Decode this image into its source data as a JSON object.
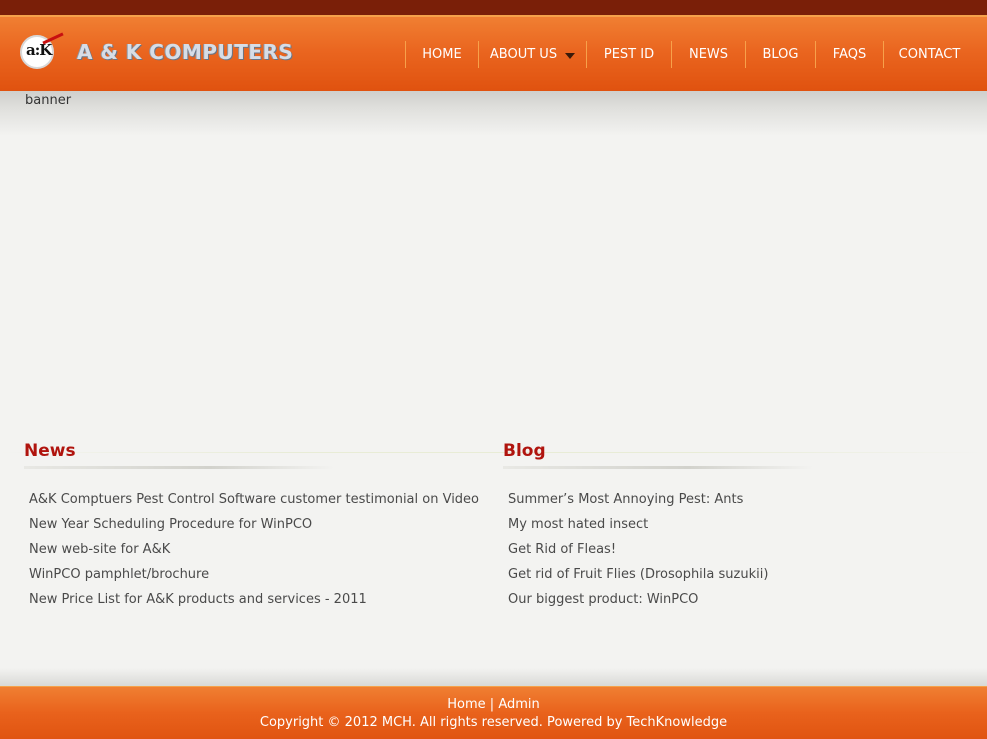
{
  "header": {
    "logo_text": "A & K COMPUTERS",
    "logo_mark": "a:K"
  },
  "nav": {
    "items": [
      {
        "label": "HOME",
        "has_dropdown": false
      },
      {
        "label": "ABOUT US",
        "has_dropdown": true
      },
      {
        "label": "PEST ID",
        "has_dropdown": false
      },
      {
        "label": "NEWS",
        "has_dropdown": false
      },
      {
        "label": "BLOG",
        "has_dropdown": false
      },
      {
        "label": "FAQS",
        "has_dropdown": false
      },
      {
        "label": "CONTACT",
        "has_dropdown": false
      }
    ]
  },
  "banner": {
    "alt_text": "banner"
  },
  "news": {
    "title": "News",
    "items": [
      "A&K Comptuers Pest Control Software customer testimonial on Video",
      "New Year Scheduling Procedure for WinPCO",
      "New web-site for A&K",
      "WinPCO pamphlet/brochure",
      "New Price List for A&K products and services - 2011"
    ]
  },
  "blog": {
    "title": "Blog",
    "items": [
      "Summer’s Most Annoying Pest: Ants",
      "My most hated insect",
      "Get Rid of Fleas!",
      "Get rid of Fruit Flies (Drosophila suzukii)",
      "Our biggest product: WinPCO"
    ]
  },
  "footer": {
    "link_home": "Home",
    "separator": "|",
    "link_admin": "Admin",
    "copyright": "Copyright © 2012 MCH. All rights reserved. Powered by TechKnowledge"
  },
  "colors": {
    "header_orange": "#e9621c",
    "top_bar": "#7a1f08",
    "heading_red": "#b0140e",
    "background": "#f3f3f1"
  }
}
